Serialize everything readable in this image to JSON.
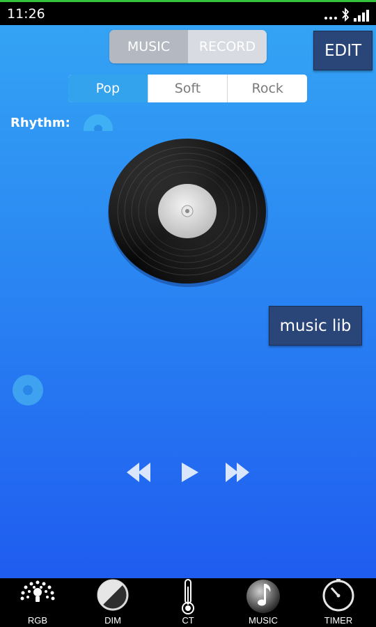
{
  "status_bar": {
    "time": "11:26",
    "icons": [
      "notification-dots-icon",
      "bluetooth-icon",
      "signal-icon"
    ]
  },
  "mode_toggle": {
    "options": [
      "MUSIC",
      "RECORD"
    ],
    "selected": "MUSIC"
  },
  "edit_label": "EDIT",
  "genre_tabs": {
    "options": [
      "Pop",
      "Soft",
      "Rock"
    ],
    "selected": "Pop"
  },
  "rhythm_label": "Rhythm:",
  "music_lib_label": "music lib",
  "transport": {
    "icons": [
      "previous-icon",
      "play-icon",
      "next-icon"
    ]
  },
  "bottom_nav": {
    "items": [
      {
        "label": "RGB",
        "icon": "rgb-icon"
      },
      {
        "label": "DIM",
        "icon": "dim-icon"
      },
      {
        "label": "CT",
        "icon": "thermometer-icon"
      },
      {
        "label": "MUSIC",
        "icon": "music-note-icon"
      },
      {
        "label": "TIMER",
        "icon": "timer-icon"
      }
    ],
    "selected": "MUSIC"
  },
  "colors": {
    "background_top": "#34a3f4",
    "background_bottom": "#1f5cf0",
    "button_dark": "#2a4678",
    "tab_active": "#34a3ee",
    "status_accent": "#31c43a"
  }
}
